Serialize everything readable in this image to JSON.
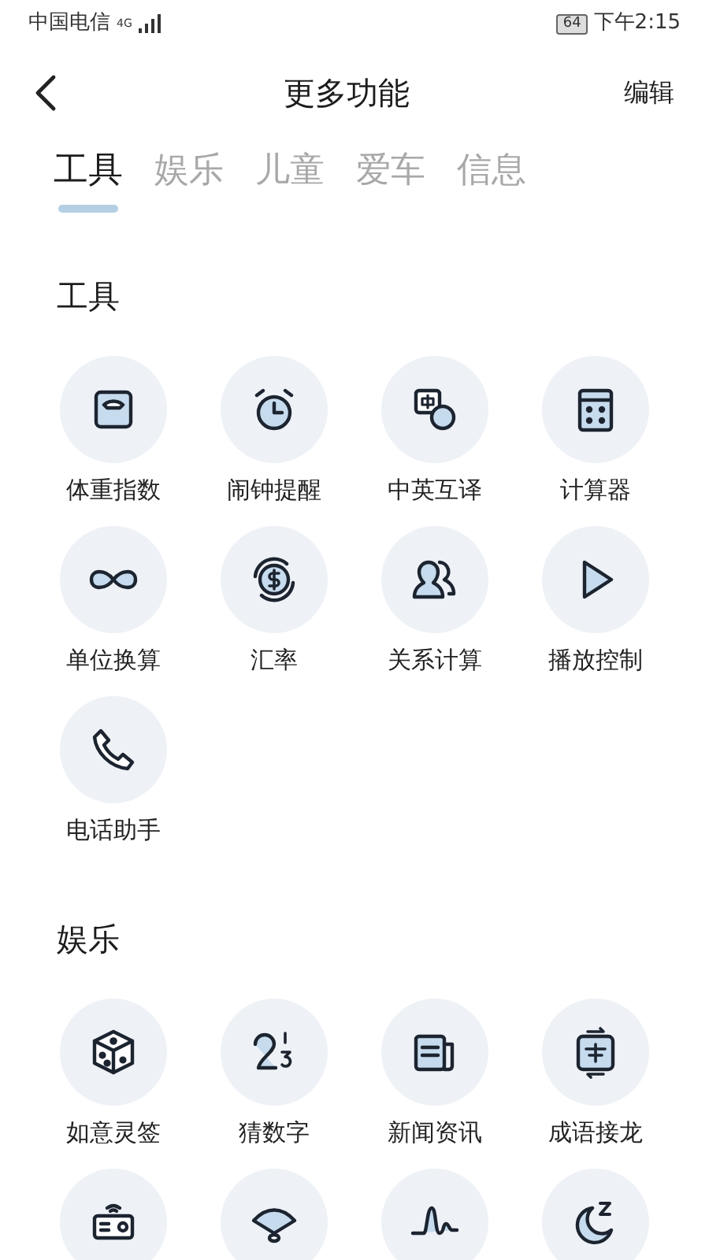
{
  "status_bar": {
    "carrier": "中国电信",
    "network": "4G",
    "battery": "64",
    "time": "下午2:15"
  },
  "header": {
    "title": "更多功能",
    "action": "编辑"
  },
  "tabs": [
    {
      "label": "工具",
      "selected": true
    },
    {
      "label": "娱乐",
      "selected": false
    },
    {
      "label": "儿童",
      "selected": false
    },
    {
      "label": "爱车",
      "selected": false
    },
    {
      "label": "信息",
      "selected": false
    }
  ],
  "sections": [
    {
      "title": "工具",
      "items": [
        {
          "kind": "labeled",
          "label": "体重指数"
        },
        {
          "kind": "labeled",
          "label": "闹钟提醒"
        },
        {
          "kind": "labeled",
          "label": "中英互译"
        },
        {
          "kind": "labeled",
          "label": "计算器"
        },
        {
          "kind": "labeled",
          "label": "单位换算"
        },
        {
          "kind": "labeled",
          "label": "汇率"
        },
        {
          "kind": "labeled",
          "label": "关系计算"
        },
        {
          "kind": "labeled",
          "label": "播放控制"
        },
        {
          "kind": "labeled",
          "label": "电话助手"
        }
      ]
    },
    {
      "title": "娱乐",
      "items": [
        {
          "kind": "labeled",
          "label": "如意灵签"
        },
        {
          "kind": "labeled",
          "label": "猜数字"
        },
        {
          "kind": "labeled",
          "label": "新闻资讯"
        },
        {
          "kind": "labeled",
          "label": "成语接龙"
        },
        {
          "kind": "icon"
        },
        {
          "kind": "icon"
        },
        {
          "kind": "icon"
        },
        {
          "kind": "icon"
        }
      ]
    }
  ]
}
